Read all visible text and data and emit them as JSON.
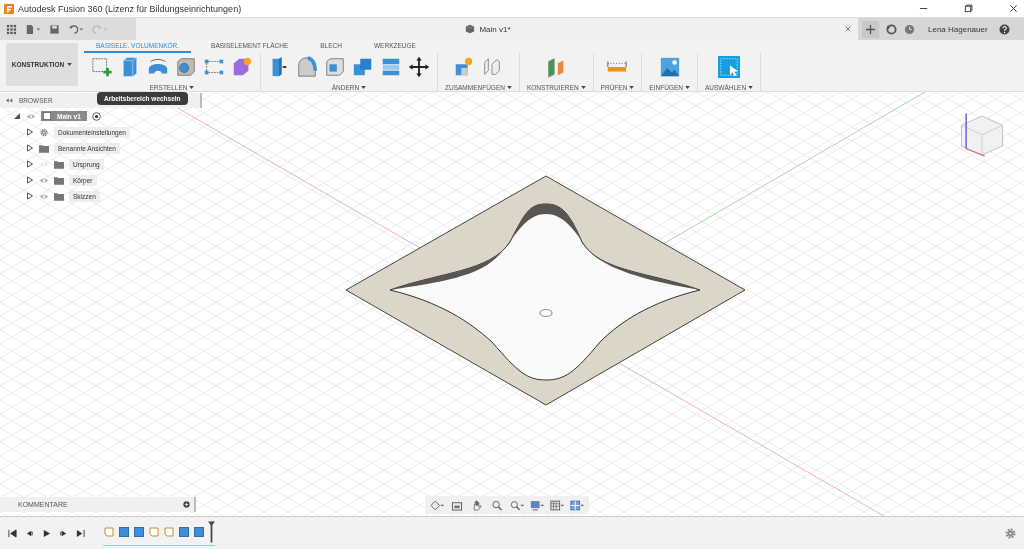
{
  "window": {
    "title": "Autodesk Fusion 360 (Lizenz für Bildungseinrichtungen)"
  },
  "document_tab": {
    "title": "Main v1*"
  },
  "user": {
    "name": "Lena Hagenauer"
  },
  "workspace": {
    "label": "KONSTRUKTION"
  },
  "toolbar_tabs": [
    {
      "label": "BASISELE. VOLUMENKÖR.",
      "selected": true
    },
    {
      "label": "BASISELEMENT FLÄCHE",
      "selected": false
    },
    {
      "label": "BLECH",
      "selected": false
    },
    {
      "label": "WERKZEUGE",
      "selected": false
    }
  ],
  "tool_groups": [
    {
      "label": "ERSTELLEN"
    },
    {
      "label": "ÄNDERN"
    },
    {
      "label": "ZUSAMMENFÜGEN"
    },
    {
      "label": "KONSTRUIEREN"
    },
    {
      "label": "PRÜFEN"
    },
    {
      "label": "EINFÜGEN"
    },
    {
      "label": "AUSWÄHLEN"
    }
  ],
  "tooltip": {
    "text": "Arbeitsbereich wechseln"
  },
  "browser": {
    "title": "BROWSER",
    "tree": [
      {
        "label": "Main v1",
        "expanded": true,
        "children": [
          {
            "label": "Dokumenteinstellungen",
            "kind": "settings",
            "expanded": false
          },
          {
            "label": "Benannte Ansichten",
            "kind": "folder",
            "expanded": false
          },
          {
            "label": "Ursprung",
            "kind": "folder",
            "expanded": false,
            "visible": false
          },
          {
            "label": "Körper",
            "kind": "folder",
            "expanded": false,
            "visible": true
          },
          {
            "label": "Skizzen",
            "kind": "folder",
            "expanded": false,
            "visible": true
          }
        ]
      }
    ]
  },
  "comments": {
    "title": "KOMMENTARE"
  }
}
